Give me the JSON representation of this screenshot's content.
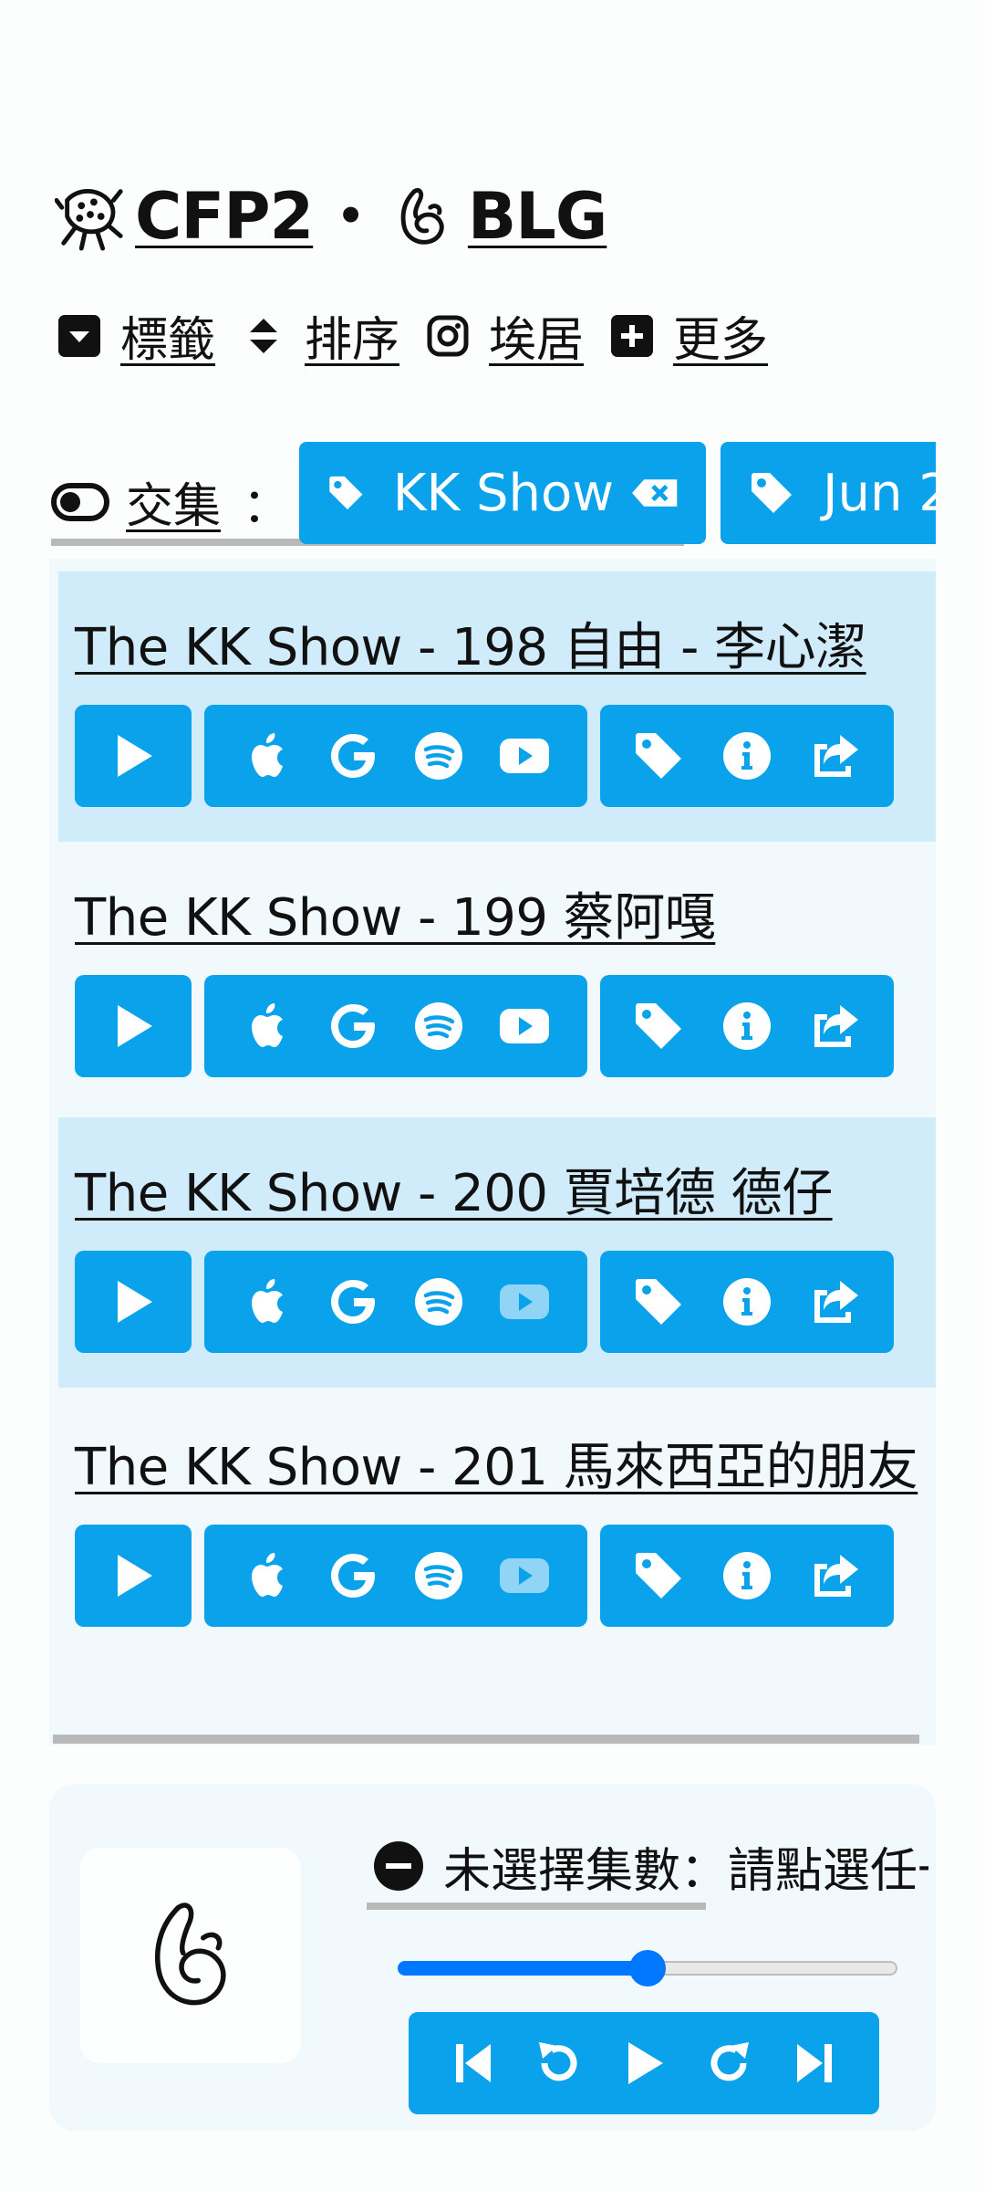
{
  "header": {
    "site_title": "CFP2",
    "separator": "•",
    "podcast_title": "BLG"
  },
  "menu": {
    "tags": "標籤",
    "sort": "排序",
    "instagram": "埃居",
    "more": "更多"
  },
  "filter": {
    "mode_label": "交集",
    "colon": "：",
    "chips": [
      {
        "label": "KK Show"
      },
      {
        "label": "Jun 2"
      }
    ]
  },
  "episodes": [
    {
      "title": "The KK Show - 198 自由 - 李心潔",
      "youtube_enabled": true
    },
    {
      "title": "The KK Show - 199 蔡阿嘎",
      "youtube_enabled": true
    },
    {
      "title": "The KK Show - 200 賈培德 德仔",
      "youtube_enabled": false
    },
    {
      "title": "The KK Show - 201 馬來西亞的朋友",
      "youtube_enabled": false
    }
  ],
  "player": {
    "status_text": "未選擇集數：請點選任一集",
    "progress_fraction": 0.5
  },
  "colors": {
    "accent": "#0aa2ea",
    "slider": "#0077ff",
    "row_alt": "#d0ebfa",
    "list_bg": "#f2f9fd"
  },
  "icons": {
    "logo": "squid-icon",
    "podcast": "ok-hand-icon",
    "tags": "caret-square-down-icon",
    "sort": "sort-icon",
    "instagram": "instagram-icon",
    "more": "plus-square-icon"
  }
}
